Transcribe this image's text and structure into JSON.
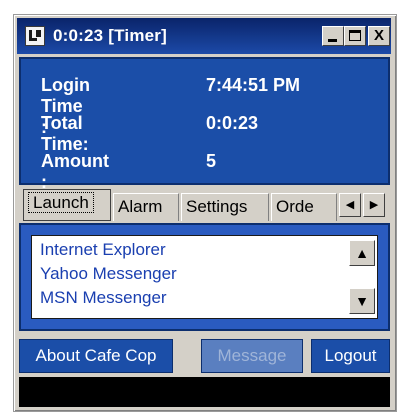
{
  "window": {
    "title": "0:0:23 [Timer]",
    "controls": {
      "minimize_label": "",
      "maximize_label": "",
      "close_label": "X"
    }
  },
  "info": {
    "login_time_label": "Login Time :",
    "login_time_value": "7:44:51 PM",
    "total_time_label": "Total Time:",
    "total_time_value": "0:0:23",
    "amount_label": "Amount :",
    "amount_value": "5"
  },
  "tabs": [
    {
      "label": "Launch",
      "active": true
    },
    {
      "label": "Alarm",
      "active": false
    },
    {
      "label": "Settings",
      "active": false
    },
    {
      "label": "Orde",
      "active": false
    }
  ],
  "tab_scroll": {
    "left": "◀",
    "right": "▶"
  },
  "launch_list": {
    "items": [
      "Internet Explorer",
      "Yahoo Messenger",
      "MSN Messenger"
    ],
    "scroll_up": "▲",
    "scroll_down": "▼"
  },
  "buttons": {
    "about": "About Cafe Cop",
    "message": "Message",
    "logout": "Logout"
  },
  "colors": {
    "panel_blue": "#1b4ea8",
    "title_gradient_start": "#0a246a",
    "list_text": "#1a3fb0"
  }
}
